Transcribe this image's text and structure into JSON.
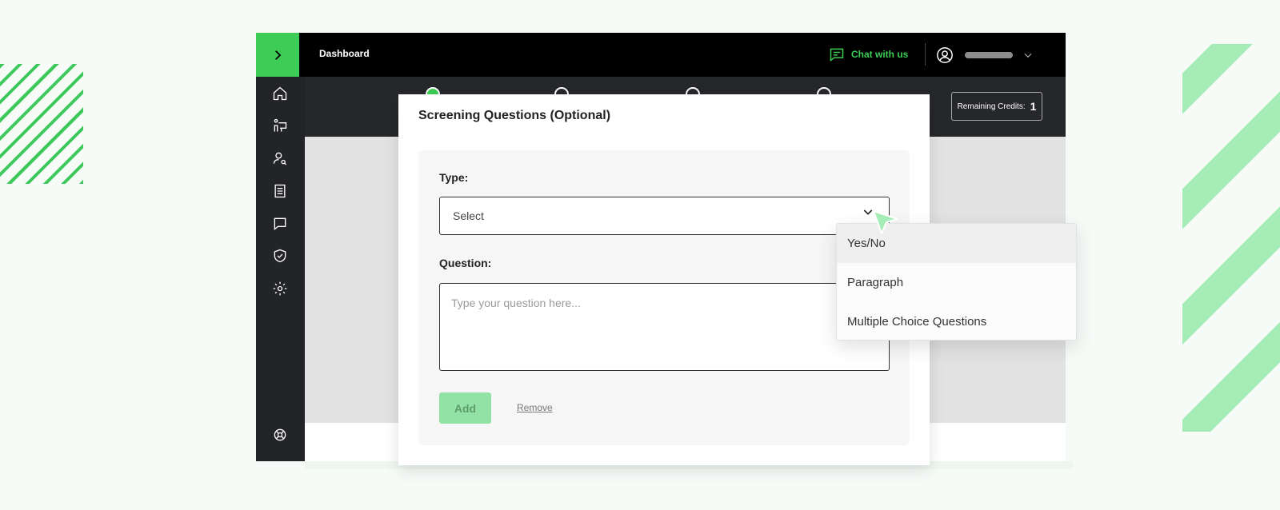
{
  "topbar": {
    "title": "Dashboard",
    "chat_label": "Chat with us"
  },
  "credits": {
    "label": "Remaining Credits:",
    "value": "1"
  },
  "modal": {
    "title": "Screening Questions (Optional)",
    "type_label": "Type:",
    "select_value": "Select",
    "question_label": "Question:",
    "question_placeholder": "Type your question here...",
    "add_label": "Add",
    "remove_label": "Remove"
  },
  "dropdown": {
    "options": [
      "Yes/No",
      "Paragraph",
      "Multiple Choice Questions"
    ],
    "highlighted": "Yes/No"
  },
  "sidebar": {
    "icons": [
      "home-icon",
      "candidates-icon",
      "user-search-icon",
      "cv-icon",
      "chat-icon",
      "shield-check-icon",
      "gear-icon",
      "support-icon"
    ]
  },
  "colors": {
    "accent": "#3dcc55",
    "accent_light": "#93e2a5",
    "topbar": "#000000",
    "sidebar": "#232427"
  }
}
